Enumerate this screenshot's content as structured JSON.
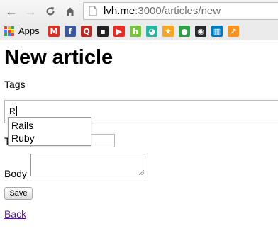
{
  "browser": {
    "url_host": "lvh.me",
    "url_path": ":3000/articles/new",
    "nav": {
      "back": "←",
      "forward": "→",
      "reload": "C",
      "home": "⌂"
    }
  },
  "bookmarks": {
    "apps_label": "Apps",
    "items": [
      {
        "name": "gmail-icon",
        "glyph": "M",
        "color": "#d93025"
      },
      {
        "name": "facebook-icon",
        "glyph": "f",
        "color": "#3b5998"
      },
      {
        "name": "quora-icon",
        "glyph": "Q",
        "color": "#b92b27"
      },
      {
        "name": "tv-icon",
        "glyph": "▪",
        "color": "#222222"
      },
      {
        "name": "youtube-icon",
        "glyph": "▶",
        "color": "#e52d27"
      },
      {
        "name": "houzz-icon",
        "glyph": "h",
        "color": "#7ac142"
      },
      {
        "name": "chat-icon",
        "glyph": "◕",
        "color": "#2bb5a1"
      },
      {
        "name": "bookmark-star-icon",
        "glyph": "★",
        "color": "#f5a623"
      },
      {
        "name": "green-circle-icon",
        "glyph": "●",
        "color": "#2e9e44"
      },
      {
        "name": "github-icon",
        "glyph": "◉",
        "color": "#24292e"
      },
      {
        "name": "trello-icon",
        "glyph": "▥",
        "color": "#0079bf"
      },
      {
        "name": "chart-icon",
        "glyph": "↗",
        "color": "#f7931e"
      }
    ]
  },
  "page": {
    "title": "New article",
    "tags": {
      "label": "Tags",
      "value": "R"
    },
    "title_field": {
      "label_visible": "T"
    },
    "body": {
      "label": "Body"
    },
    "save_label": "Save",
    "back_label": "Back"
  },
  "autocomplete": {
    "options": [
      "Rails",
      "Ruby"
    ]
  },
  "colors": {
    "link": "#551a8b",
    "chrome": "#ebebeb",
    "apps_grid": [
      "#e94235",
      "#fabb05",
      "#34a853",
      "#4285f4",
      "#e94235",
      "#fabb05",
      "#34a853",
      "#4285f4",
      "#e94235"
    ]
  }
}
